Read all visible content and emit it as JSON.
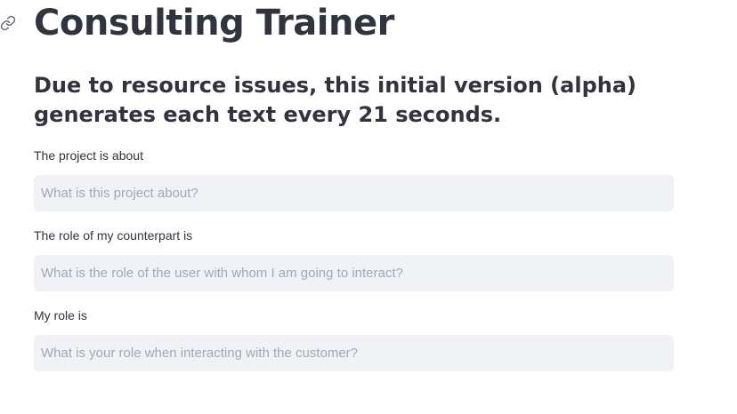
{
  "header": {
    "anchor_icon": "link-icon",
    "title": "Consulting Trainer",
    "subtitle": "Due to resource issues, this initial version (alpha) generates each text every 21 seconds."
  },
  "form": {
    "project": {
      "label": "The project is about",
      "value": "",
      "placeholder": "What is this project about?"
    },
    "counterpart_role": {
      "label": "The role of my counterpart is",
      "value": "",
      "placeholder": "What is the role of the user with whom I am going to interact?"
    },
    "my_role": {
      "label": "My role is",
      "value": "",
      "placeholder": "What is your role when interacting with the customer?"
    }
  },
  "colors": {
    "text": "#31333f",
    "input_background": "#f0f2f6",
    "placeholder": "#a3a8b4"
  }
}
